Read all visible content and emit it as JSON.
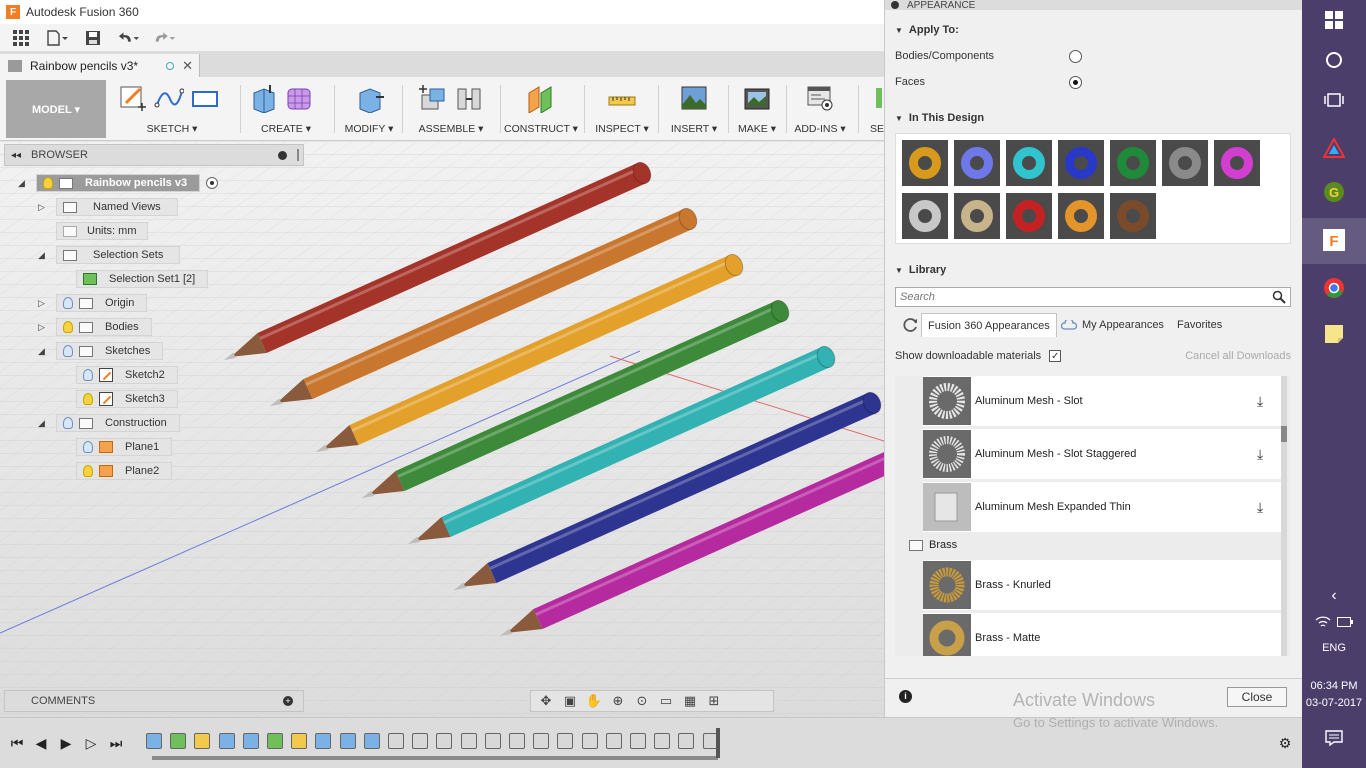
{
  "window": {
    "title": "Autodesk Fusion 360"
  },
  "document": {
    "tab_name": "Rainbow pencils v3*"
  },
  "ribbon": {
    "workspace": "MODEL ▾",
    "groups": [
      "SKETCH ▾",
      "CREATE ▾",
      "MODIFY ▾",
      "ASSEMBLE ▾",
      "CONSTRUCT ▾",
      "INSPECT ▾",
      "INSERT ▾",
      "MAKE ▾",
      "ADD-INS ▾",
      "SE"
    ]
  },
  "browser": {
    "title": "BROWSER",
    "root": "Rainbow pencils v3",
    "items": [
      {
        "label": "Named Views"
      },
      {
        "label": "Units: mm"
      },
      {
        "label": "Selection Sets"
      },
      {
        "label": "Selection Set1 [2]"
      },
      {
        "label": "Origin"
      },
      {
        "label": "Bodies"
      },
      {
        "label": "Sketches"
      },
      {
        "label": "Sketch2"
      },
      {
        "label": "Sketch3"
      },
      {
        "label": "Construction"
      },
      {
        "label": "Plane1"
      },
      {
        "label": "Plane2"
      }
    ]
  },
  "comments": {
    "title": "COMMENTS"
  },
  "pencils": [
    {
      "color": "#a4342a",
      "name": "red"
    },
    {
      "color": "#c9772f",
      "name": "orange"
    },
    {
      "color": "#e3a12c",
      "name": "yellow"
    },
    {
      "color": "#3c8a3a",
      "name": "green"
    },
    {
      "color": "#33b2b4",
      "name": "cyan"
    },
    {
      "color": "#2e3590",
      "name": "blue"
    },
    {
      "color": "#b52a9f",
      "name": "magenta"
    }
  ],
  "appearance": {
    "panel_title": "APPEARANCE",
    "apply_to_heading": "Apply To:",
    "apply_options": [
      "Bodies/Components",
      "Faces"
    ],
    "in_design_heading": "In This Design",
    "swatches": [
      {
        "color": "#d89a1c",
        "icon": "gold-torus"
      },
      {
        "color": "#6f78e8",
        "icon": "lavender-torus"
      },
      {
        "color": "#30c4cf",
        "icon": "cyan-torus"
      },
      {
        "color": "#2838c8",
        "icon": "blue-torus"
      },
      {
        "color": "#1f8a3a",
        "icon": "green-torus"
      },
      {
        "color": "#8a8a8a",
        "icon": "gray-torus"
      },
      {
        "color": "#d23fd0",
        "icon": "magenta-torus"
      },
      {
        "color": "#c8c8c8",
        "icon": "silver-torus"
      },
      {
        "color": "#c7b48a",
        "icon": "tan-torus"
      },
      {
        "color": "#c42222",
        "icon": "red-torus"
      },
      {
        "color": "#e3942a",
        "icon": "orange-torus"
      },
      {
        "color": "#7a4a2a",
        "icon": "brown-torus"
      }
    ],
    "library_heading": "Library",
    "search_placeholder": "Search",
    "tabs": [
      "Fusion 360 Appearances",
      "My Appearances",
      "Favorites"
    ],
    "show_downloadable": "Show downloadable materials",
    "cancel_downloads": "Cancel all Downloads",
    "materials": [
      {
        "name": "Aluminum Mesh - Slot",
        "download": true
      },
      {
        "name": "Aluminum Mesh - Slot Staggered",
        "download": true
      },
      {
        "name": "Aluminum Mesh Expanded Thin",
        "download": true
      }
    ],
    "category": "Brass",
    "brass_materials": [
      {
        "name": "Brass - Knurled"
      },
      {
        "name": "Brass - Matte"
      }
    ],
    "close_label": "Close"
  },
  "watermark": {
    "line1": "Activate Windows",
    "line2": "Go to Settings to activate Windows."
  },
  "taskbar": {
    "language": "ENG",
    "time": "06:34 PM",
    "date": "03-07-2017"
  }
}
